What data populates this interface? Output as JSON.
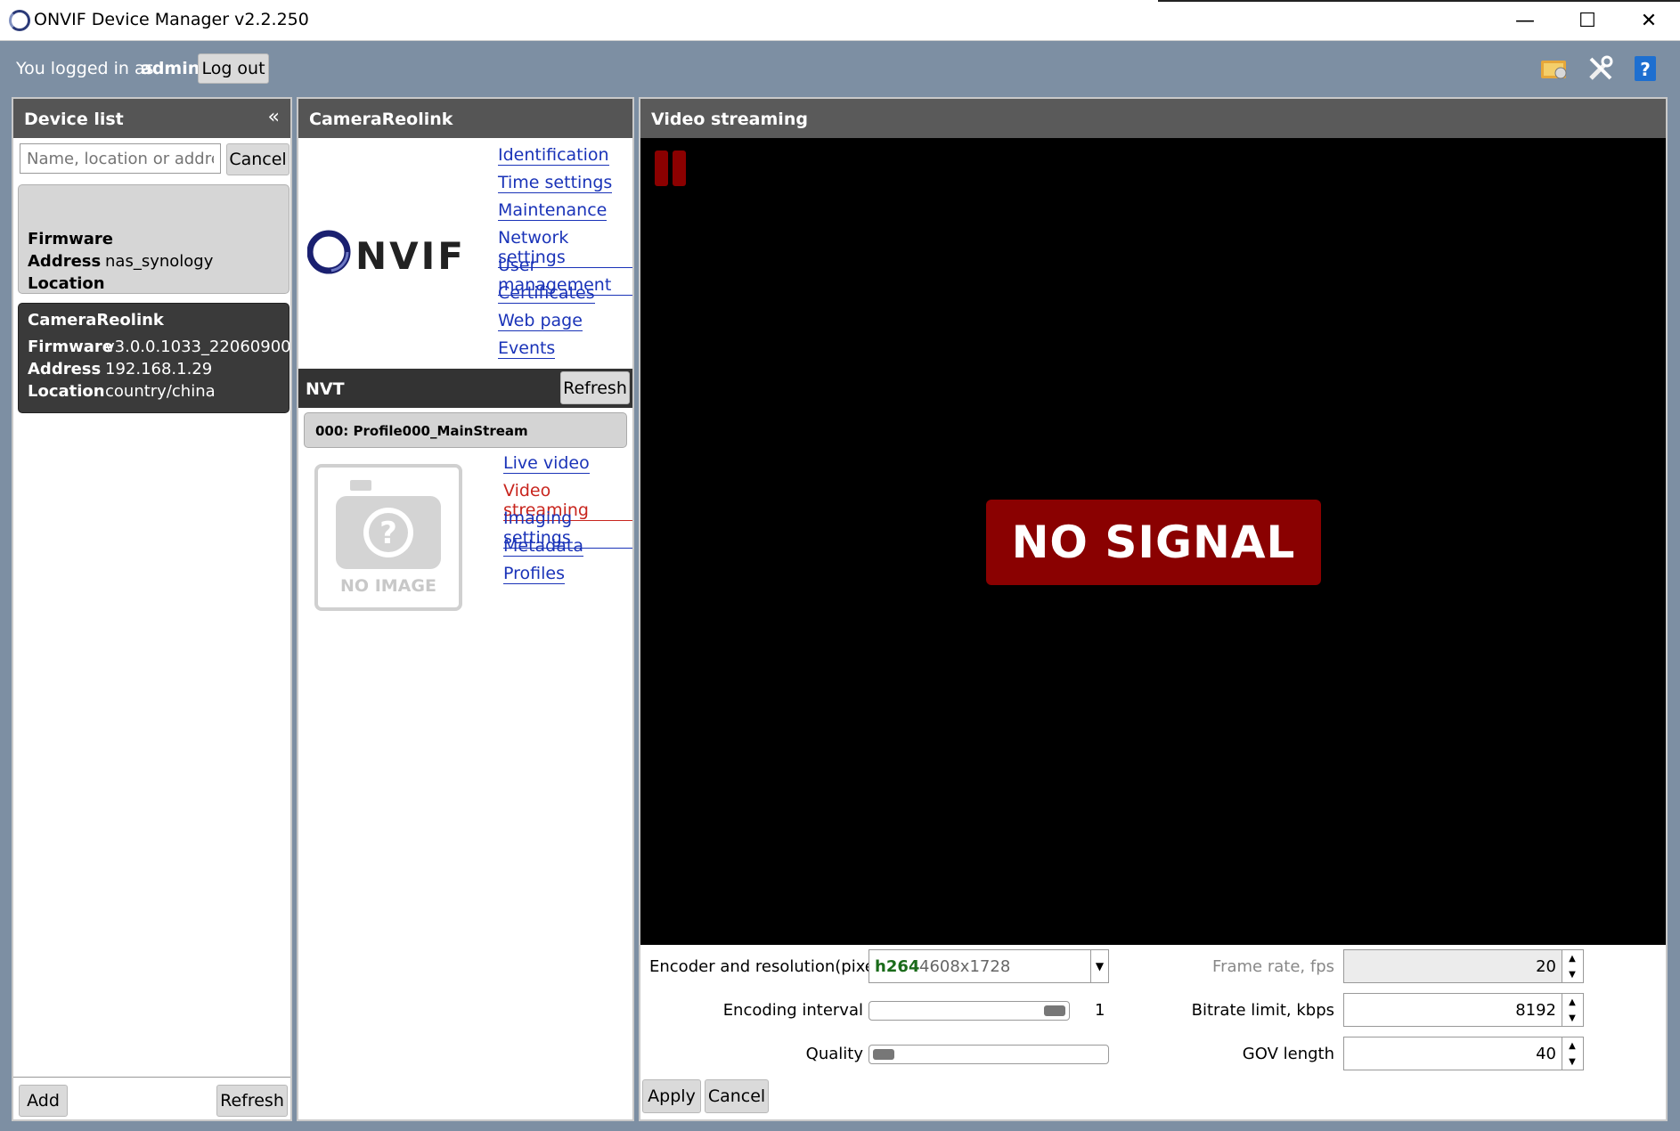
{
  "window": {
    "title": "ONVIF Device Manager v2.2.250",
    "minimize_glyph": "—",
    "maximize_glyph": "☐",
    "close_glyph": "✕"
  },
  "login": {
    "text": "You logged in as",
    "user": "admin",
    "logout_label": "Log out"
  },
  "device_list": {
    "title": "Device list",
    "collapse_glyph": "«",
    "search_placeholder": "Name, location or address",
    "cancel_label": "Cancel",
    "add_label": "Add",
    "refresh_label": "Refresh",
    "devices": [
      {
        "name": "",
        "firmware_label": "Firmware",
        "firmware": "",
        "address_label": "Address",
        "address": "nas_synology",
        "location_label": "Location",
        "location": "",
        "selected": false
      },
      {
        "name": "CameraReolink",
        "firmware_label": "Firmware",
        "firmware": "v3.0.0.1033_22060900",
        "address_label": "Address",
        "address": "192.168.1.29",
        "location_label": "Location",
        "location": "country/china",
        "selected": true
      }
    ]
  },
  "camera": {
    "title": "CameraReolink",
    "logo_text": "NVIF",
    "device_links": [
      "Identification",
      "Time settings",
      "Maintenance",
      "Network settings",
      "User management",
      "Certificates",
      "Web page",
      "Events"
    ],
    "nvt_title": "NVT",
    "nvt_refresh_label": "Refresh",
    "profile_name": "000: Profile000_MainStream",
    "no_image_text": "NO IMAGE",
    "profile_links": [
      "Live video",
      "Video streaming",
      "Imaging settings",
      "Metadata",
      "Profiles"
    ],
    "active_link": "Video streaming"
  },
  "video": {
    "title": "Video streaming",
    "no_signal": "NO SIGNAL",
    "encoder_label": "Encoder and resolution(pixels)",
    "codec": "h264",
    "resolution": "4608x1728",
    "encoding_interval_label": "Encoding interval",
    "encoding_interval_value": "1",
    "quality_label": "Quality",
    "frame_rate_label": "Frame rate, fps",
    "frame_rate": "20",
    "bitrate_label": "Bitrate limit, kbps",
    "bitrate": "8192",
    "gov_label": "GOV length",
    "gov": "40",
    "apply_label": "Apply",
    "cancel_label": "Cancel",
    "colors": {
      "no_signal_bg": "#8a0101",
      "codec_text": "#1a6b1a"
    }
  }
}
